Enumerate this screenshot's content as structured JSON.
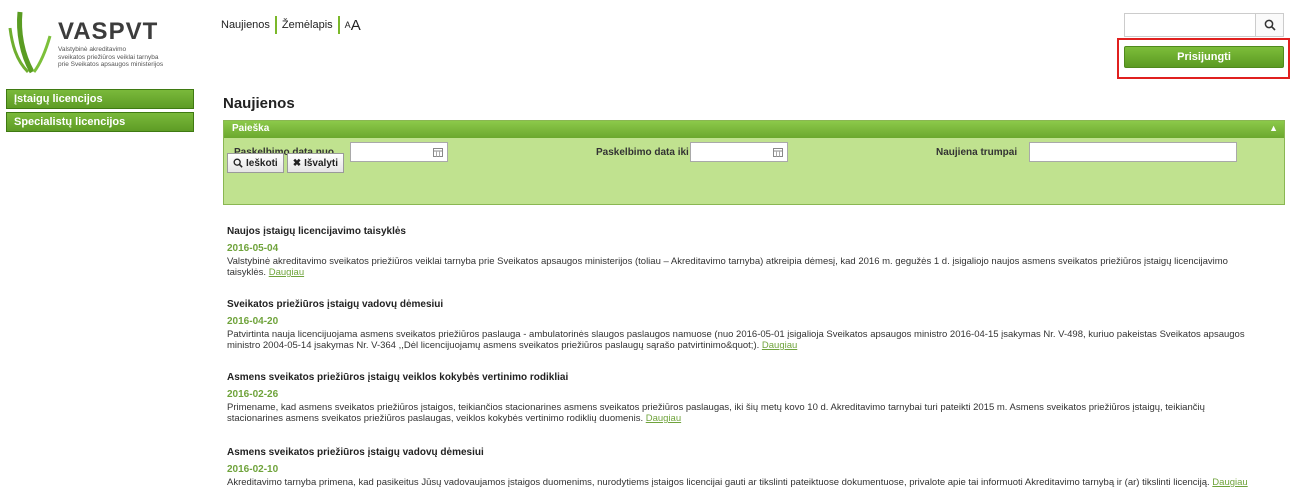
{
  "logo": {
    "title": "VASPVT",
    "subtitle_lines": [
      "Valstybinė akreditavimo",
      "sveikatos priežiūros veiklai tarnyba",
      "prie Sveikatos apsaugos ministerijos"
    ]
  },
  "topnav": {
    "news": "Naujienos",
    "map": "Žemėlapis",
    "font_small": "A",
    "font_big": "A"
  },
  "search": {
    "placeholder": "",
    "icon": "search-icon"
  },
  "login": {
    "label": "Prisijungti"
  },
  "sidebar": {
    "items": [
      {
        "label": "Įstaigų licencijos"
      },
      {
        "label": "Specialistų licencijos"
      }
    ]
  },
  "main": {
    "title": "Naujienos",
    "search_panel": {
      "header": "Paieška",
      "date_from_label": "Paskelbimo data nuo",
      "date_to_label": "Paskelbimo data iki",
      "short_label": "Naujiena trumpai",
      "search_btn": "Ieškoti",
      "clear_btn": "Išvalyti"
    },
    "more_label": "Daugiau",
    "news": [
      {
        "title": "Naujos įstaigų licencijavimo taisyklės",
        "date": "2016-05-04",
        "line1": "Valstybinė akreditavimo sveikatos priežiūros veiklai tarnyba prie Sveikatos apsaugos ministerijos (toliau – Akreditavimo tarnyba) atkreipia dėmesį, kad 2016 m. gegužės 1 d. įsigaliojo naujos asmens sveikatos priežiūros įstaigų licencijavimo",
        "line2": "taisyklės."
      },
      {
        "title": "Sveikatos priežiūros įstaigų vadovų dėmesiui",
        "date": "2016-04-20",
        "line1": "Patvirtinta nauja licencijuojama asmens sveikatos priežiūros paslauga - ambulatorinės slaugos paslaugos namuose (nuo 2016-05-01 įsigalioja Sveikatos apsaugos ministro 2016-04-15 įsakymas Nr. V-498, kuriuo pakeistas Sveikatos apsaugos",
        "line2": "ministro 2004-05-14 įsakymas Nr. V-364 ,,Dėl licencijuojamų asmens sveikatos priežiūros paslaugų sąrašo patvirtinimo&quot;)."
      },
      {
        "title": "Asmens sveikatos priežiūros įstaigų veiklos kokybės vertinimo rodikliai",
        "date": "2016-02-26",
        "line1": "Primename, kad asmens sveikatos priežiūros įstaigos, teikiančios stacionarines asmens sveikatos priežiūros paslaugas, iki šių metų kovo 10 d. Akreditavimo tarnybai turi pateikti 2015 m. Asmens sveikatos priežiūros įstaigų, teikiančių",
        "line2": "stacionarines asmens sveikatos priežiūros paslaugas, veiklos kokybės vertinimo rodiklių duomenis."
      },
      {
        "title": "Asmens sveikatos priežiūros įstaigų vadovų dėmesiui",
        "date": "2016-02-10",
        "line1": "Akreditavimo tarnyba primena, kad pasikeitus Jūsų vadovaujamos įstaigos duomenims, nurodytiems įstaigos licencijai gauti ar tikslinti pateiktuose dokumentuose, privalote apie tai informuoti Akreditavimo tarnybą ir (ar) tikslinti licenciją.",
        "line2": ""
      }
    ]
  }
}
